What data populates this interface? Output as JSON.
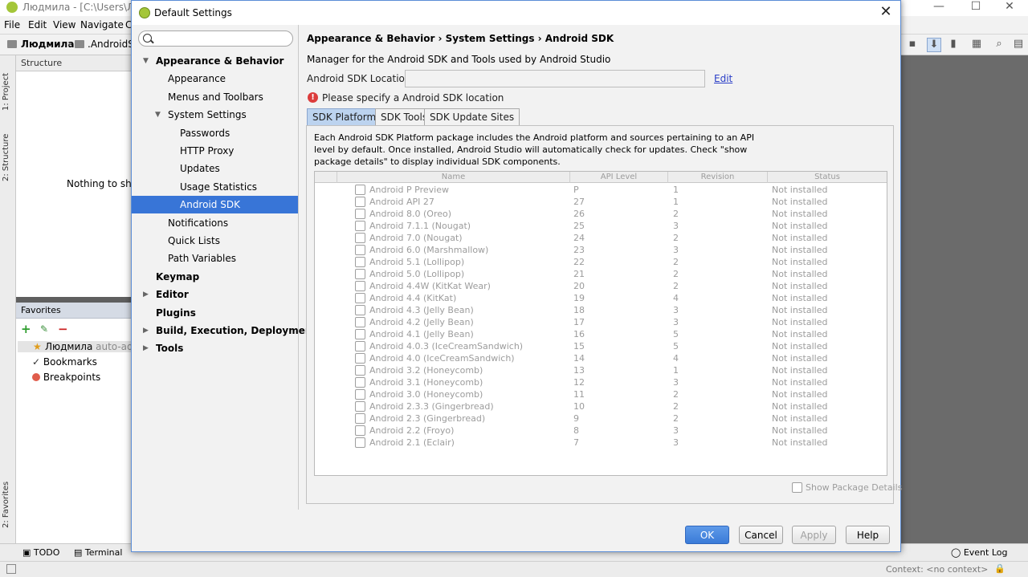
{
  "ide": {
    "window_title": "Людмила - [C:\\Users\\Людм",
    "menu": [
      "File",
      "Edit",
      "View",
      "Navigate",
      "C"
    ],
    "nav_crumbs": [
      "Людмила",
      ".AndroidSt"
    ],
    "side_tabs": [
      "1: Project",
      "2: Structure",
      "2: Favorites"
    ],
    "structure_header": "Structure",
    "structure_empty": "Nothing to show",
    "favorites_header": "Favorites",
    "favorites": [
      {
        "name": "Людмила",
        "suffix": "auto-added"
      },
      {
        "name": "Bookmarks",
        "suffix": ""
      },
      {
        "name": "Breakpoints",
        "suffix": ""
      }
    ],
    "bottom_tabs": [
      "TODO",
      "Terminal"
    ],
    "event_log": "Event Log",
    "status_context": "Context: <no context>"
  },
  "dialog": {
    "title": "Default Settings",
    "close_glyph": "✕",
    "search_placeholder": "",
    "tree": [
      {
        "label": "Appearance & Behavior",
        "level": 0,
        "bold": true,
        "expanded": true
      },
      {
        "label": "Appearance",
        "level": 1
      },
      {
        "label": "Menus and Toolbars",
        "level": 1
      },
      {
        "label": "System Settings",
        "level": 1,
        "expanded": true
      },
      {
        "label": "Passwords",
        "level": 2
      },
      {
        "label": "HTTP Proxy",
        "level": 2
      },
      {
        "label": "Updates",
        "level": 2
      },
      {
        "label": "Usage Statistics",
        "level": 2
      },
      {
        "label": "Android SDK",
        "level": 2,
        "selected": true
      },
      {
        "label": "Notifications",
        "level": 1
      },
      {
        "label": "Quick Lists",
        "level": 1
      },
      {
        "label": "Path Variables",
        "level": 1
      },
      {
        "label": "Keymap",
        "level": 0,
        "bold": true
      },
      {
        "label": "Editor",
        "level": 0,
        "bold": true,
        "collapsed": true
      },
      {
        "label": "Plugins",
        "level": 0,
        "bold": true
      },
      {
        "label": "Build, Execution, Deployment",
        "level": 0,
        "bold": true,
        "collapsed": true
      },
      {
        "label": "Tools",
        "level": 0,
        "bold": true,
        "collapsed": true
      }
    ],
    "breadcrumb": "Appearance & Behavior  ›  System Settings  ›  Android SDK",
    "description": "Manager for the Android SDK and Tools used by Android Studio",
    "location_label": "Android SDK Location:",
    "location_value": "",
    "edit_label": "Edit",
    "error_text": "Please specify a Android SDK location",
    "tabs": [
      "SDK Platforms",
      "SDK Tools",
      "SDK Update Sites"
    ],
    "active_tab": "SDK Platforms",
    "tab_description": "Each Android SDK Platform package includes the Android platform and sources pertaining to an API level by default. Once installed, Android Studio will automatically check for updates. Check \"show package details\" to display individual SDK components.",
    "columns": [
      "Name",
      "API Level",
      "Revision",
      "Status"
    ],
    "packages": [
      {
        "name": "Android P Preview",
        "api": "P",
        "rev": "1",
        "status": "Not installed"
      },
      {
        "name": "Android API 27",
        "api": "27",
        "rev": "1",
        "status": "Not installed"
      },
      {
        "name": "Android 8.0 (Oreo)",
        "api": "26",
        "rev": "2",
        "status": "Not installed"
      },
      {
        "name": "Android 7.1.1 (Nougat)",
        "api": "25",
        "rev": "3",
        "status": "Not installed"
      },
      {
        "name": "Android 7.0 (Nougat)",
        "api": "24",
        "rev": "2",
        "status": "Not installed"
      },
      {
        "name": "Android 6.0 (Marshmallow)",
        "api": "23",
        "rev": "3",
        "status": "Not installed"
      },
      {
        "name": "Android 5.1 (Lollipop)",
        "api": "22",
        "rev": "2",
        "status": "Not installed"
      },
      {
        "name": "Android 5.0 (Lollipop)",
        "api": "21",
        "rev": "2",
        "status": "Not installed"
      },
      {
        "name": "Android 4.4W (KitKat Wear)",
        "api": "20",
        "rev": "2",
        "status": "Not installed"
      },
      {
        "name": "Android 4.4 (KitKat)",
        "api": "19",
        "rev": "4",
        "status": "Not installed"
      },
      {
        "name": "Android 4.3 (Jelly Bean)",
        "api": "18",
        "rev": "3",
        "status": "Not installed"
      },
      {
        "name": "Android 4.2 (Jelly Bean)",
        "api": "17",
        "rev": "3",
        "status": "Not installed"
      },
      {
        "name": "Android 4.1 (Jelly Bean)",
        "api": "16",
        "rev": "5",
        "status": "Not installed"
      },
      {
        "name": "Android 4.0.3 (IceCreamSandwich)",
        "api": "15",
        "rev": "5",
        "status": "Not installed"
      },
      {
        "name": "Android 4.0 (IceCreamSandwich)",
        "api": "14",
        "rev": "4",
        "status": "Not installed"
      },
      {
        "name": "Android 3.2 (Honeycomb)",
        "api": "13",
        "rev": "1",
        "status": "Not installed"
      },
      {
        "name": "Android 3.1 (Honeycomb)",
        "api": "12",
        "rev": "3",
        "status": "Not installed"
      },
      {
        "name": "Android 3.0 (Honeycomb)",
        "api": "11",
        "rev": "2",
        "status": "Not installed"
      },
      {
        "name": "Android 2.3.3 (Gingerbread)",
        "api": "10",
        "rev": "2",
        "status": "Not installed"
      },
      {
        "name": "Android 2.3 (Gingerbread)",
        "api": "9",
        "rev": "2",
        "status": "Not installed"
      },
      {
        "name": "Android 2.2 (Froyo)",
        "api": "8",
        "rev": "3",
        "status": "Not installed"
      },
      {
        "name": "Android 2.1 (Eclair)",
        "api": "7",
        "rev": "3",
        "status": "Not installed"
      }
    ],
    "show_details_label": "Show Package Details",
    "buttons": {
      "ok": "OK",
      "cancel": "Cancel",
      "apply": "Apply",
      "help": "Help"
    }
  },
  "colors": {
    "selection": "#3875d7",
    "primary_button": "#3a7bd8",
    "error": "#dc3c3c",
    "link": "#2a3ec7"
  }
}
